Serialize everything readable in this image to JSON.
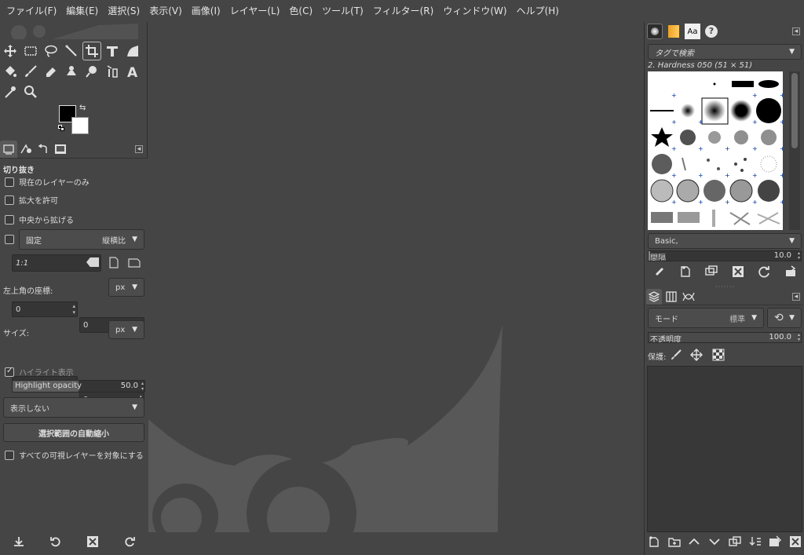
{
  "menubar": {
    "items": [
      "ファイル(F)",
      "編集(E)",
      "選択(S)",
      "表示(V)",
      "画像(I)",
      "レイヤー(L)",
      "色(C)",
      "ツール(T)",
      "フィルター(R)",
      "ウィンドウ(W)",
      "ヘルプ(H)"
    ]
  },
  "tool_options": {
    "title": "切り抜き",
    "current_layer_only": "現在のレイヤーのみ",
    "allow_growing": "拡大を許可",
    "expand_from_center": "中央から拡げる",
    "fixed_label": "固定",
    "fixed_mode": "縦横比",
    "ratio_value": "1:1",
    "position_label": "左上角の座標:",
    "position_unit": "px",
    "position_x": "0",
    "position_y": "0",
    "size_label": "サイズ:",
    "size_unit": "px",
    "size_w": "0",
    "size_h": "0",
    "highlight_label": "ハイライト表示",
    "highlight_opacity_label": "Highlight opacity",
    "highlight_opacity_value": "50.0",
    "guides_value": "表示しない",
    "auto_shrink_button": "選択範囲の自動縮小",
    "all_visible_layers": "すべての可視レイヤーを対象にする"
  },
  "brushes": {
    "tag_placeholder": "タグで検索",
    "selected_brush": "2. Hardness 050 (51 × 51)",
    "preset": "Basic,",
    "spacing_label": "間隔",
    "spacing_value": "10.0"
  },
  "layers": {
    "mode_label": "モード",
    "mode_value": "標準",
    "opacity_label": "不透明度",
    "opacity_value": "100.0",
    "lock_label": "保護:"
  },
  "colors": {
    "bg": "#454545",
    "panel_dark": "#353535",
    "watermark": "#595959",
    "text": "#dcdcdc"
  }
}
